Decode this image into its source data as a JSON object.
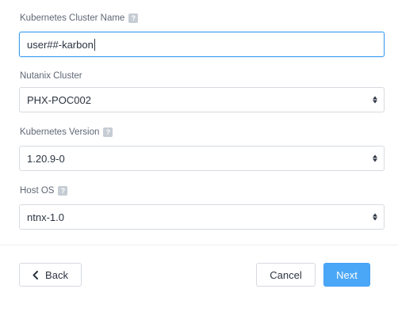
{
  "form": {
    "cluster_name": {
      "label": "Kubernetes Cluster Name",
      "value": "user##-karbon",
      "help_icon": "question-icon"
    },
    "nutanix_cluster": {
      "label": "Nutanix Cluster",
      "value": "PHX-POC002"
    },
    "k8s_version": {
      "label": "Kubernetes Version",
      "value": "1.20.9-0",
      "help_icon": "question-icon"
    },
    "host_os": {
      "label": "Host OS",
      "value": "ntnx-1.0",
      "help_icon": "question-icon"
    }
  },
  "footer": {
    "back_label": "Back",
    "cancel_label": "Cancel",
    "next_label": "Next"
  },
  "colors": {
    "accent": "#4aa7f7",
    "focus_border": "#3d9cf0",
    "label_text": "#5f6775"
  }
}
